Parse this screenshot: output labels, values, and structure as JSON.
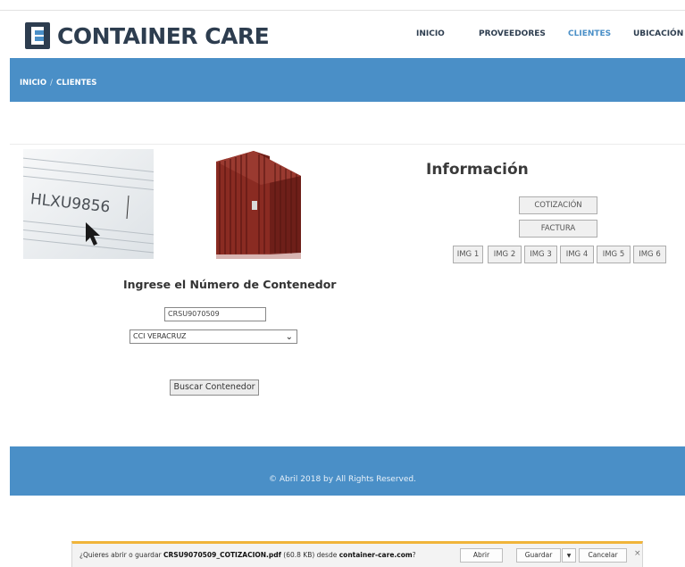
{
  "header": {
    "brand": "CONTAINER CARE",
    "nav": [
      {
        "label": "INICIO",
        "active": false
      },
      {
        "label": "PROVEEDORES",
        "active": false
      },
      {
        "label": "CLIENTES",
        "active": true
      },
      {
        "label": "UBICACIÓN",
        "active": false
      }
    ]
  },
  "breadcrumb": {
    "home": "INICIO",
    "separator": "/",
    "current": "CLIENTES"
  },
  "images": {
    "container_id_sample": "HLXU9856"
  },
  "info": {
    "title": "Información",
    "cotizacion_label": "COTIZACIÓN",
    "factura_label": "FACTURA",
    "image_buttons": [
      "IMG 1",
      "IMG 2",
      "IMG 3",
      "IMG 4",
      "IMG 5",
      "IMG 6"
    ]
  },
  "form": {
    "prompt": "Ingrese el Número de Contenedor",
    "container_number": "CRSU9070509",
    "location_selected": "CCI VERACRUZ",
    "search_button": "Buscar Contenedor"
  },
  "footer": {
    "copyright": "© Abril 2018 by All Rights Reserved."
  },
  "download_bar": {
    "prefix": "¿Quieres abrir o guardar ",
    "filename": "CRSU9070509_COTIZACION.pdf",
    "size": " (60.8 KB) desde ",
    "domain": "container-care.com",
    "suffix": "?",
    "open_label": "Abrir",
    "save_label": "Guardar",
    "cancel_label": "Cancelar",
    "close_glyph": "×"
  },
  "colors": {
    "accent": "#4a8fc7",
    "brand_dark": "#2d3d4f",
    "notification_border": "#f0b43a"
  }
}
